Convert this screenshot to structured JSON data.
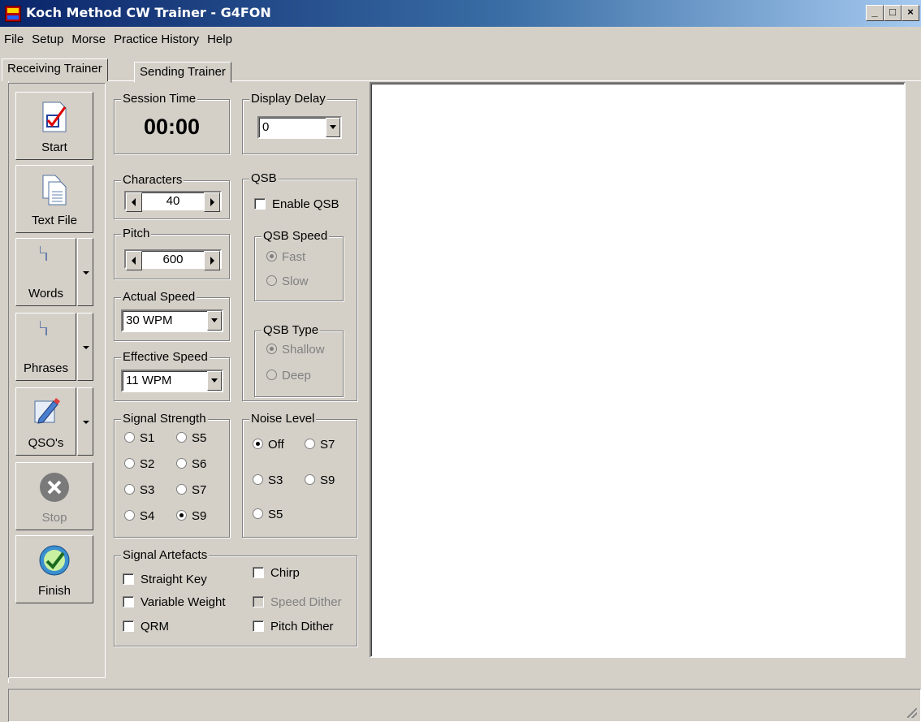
{
  "window": {
    "title": "Koch Method CW Trainer - G4FON",
    "minimize": "_",
    "maximize": "□",
    "close": "×"
  },
  "menu": [
    "File",
    "Setup",
    "Morse",
    "Practice History",
    "Help"
  ],
  "tabs": [
    {
      "label": "Receiving Trainer",
      "active": true
    },
    {
      "label": "Sending Trainer",
      "active": false
    }
  ],
  "toolbar": {
    "start": "Start",
    "text_file": "Text File",
    "words": "Words",
    "phrases": "Phrases",
    "qsos": "QSO's",
    "stop": "Stop",
    "finish": "Finish"
  },
  "session_time": {
    "label": "Session Time",
    "value": "00:00"
  },
  "display_delay": {
    "label": "Display Delay",
    "value": "0"
  },
  "characters": {
    "label": "Characters",
    "value": "40"
  },
  "pitch": {
    "label": "Pitch",
    "value": "600"
  },
  "actual_speed": {
    "label": "Actual Speed",
    "value": "30 WPM"
  },
  "effective_speed": {
    "label": "Effective Speed",
    "value": "11 WPM"
  },
  "qsb": {
    "label": "QSB",
    "enable_label": "Enable QSB",
    "speed": {
      "label": "QSB Speed",
      "options": [
        "Fast",
        "Slow"
      ],
      "selected": "Fast"
    },
    "type": {
      "label": "QSB Type",
      "options": [
        "Shallow",
        "Deep"
      ],
      "selected": "Shallow"
    }
  },
  "signal_strength": {
    "label": "Signal Strength",
    "options": [
      "S1",
      "S5",
      "S2",
      "S6",
      "S3",
      "S7",
      "S4",
      "S9"
    ],
    "selected": "S9"
  },
  "noise_level": {
    "label": "Noise Level",
    "options": [
      "Off",
      "S7",
      "S3",
      "S9",
      "S5"
    ],
    "selected": "Off"
  },
  "artefacts": {
    "label": "Signal Artefacts",
    "items": [
      "Straight Key",
      "Chirp",
      "Variable Weight",
      "Speed Dither",
      "QRM",
      "Pitch Dither"
    ]
  },
  "colors": {
    "face": "#d4d0c8",
    "title_start": "#0a246a",
    "title_end": "#a6caf0"
  }
}
